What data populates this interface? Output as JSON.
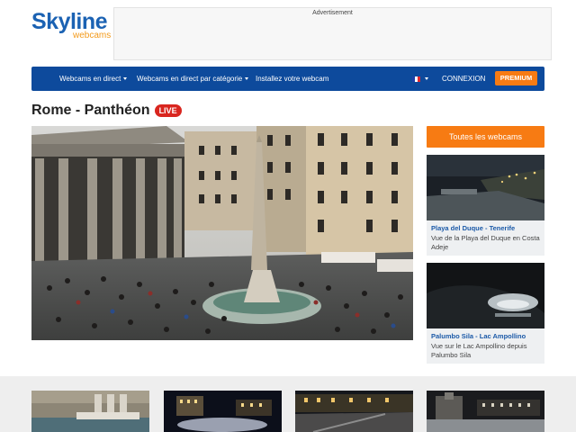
{
  "brand": {
    "name": "Skyline",
    "sub": "webcams"
  },
  "ad": {
    "label": "Advertisement"
  },
  "nav": {
    "items": [
      "Webcams en direct",
      "Webcams en direct par catégorie",
      "Installez votre webcam"
    ],
    "login": "CONNEXION",
    "premium": "PREMIUM"
  },
  "page": {
    "title": "Rome - Panthéon",
    "live_badge": "LIVE"
  },
  "sidebar": {
    "all_webcams": "Toutes les webcams",
    "cards": [
      {
        "title": "Playa del Duque - Tenerife",
        "desc": "Vue de la Playa del Duque en Costa Adeje"
      },
      {
        "title": "Palumbo Sila - Lac Ampollino",
        "desc": "Vue sur le Lac Ampollino depuis Palumbo Sila"
      }
    ]
  },
  "colors": {
    "nav_bg": "#0d4a9c",
    "accent": "#f77b13",
    "live": "#d9261f",
    "link": "#1c5aa8"
  }
}
